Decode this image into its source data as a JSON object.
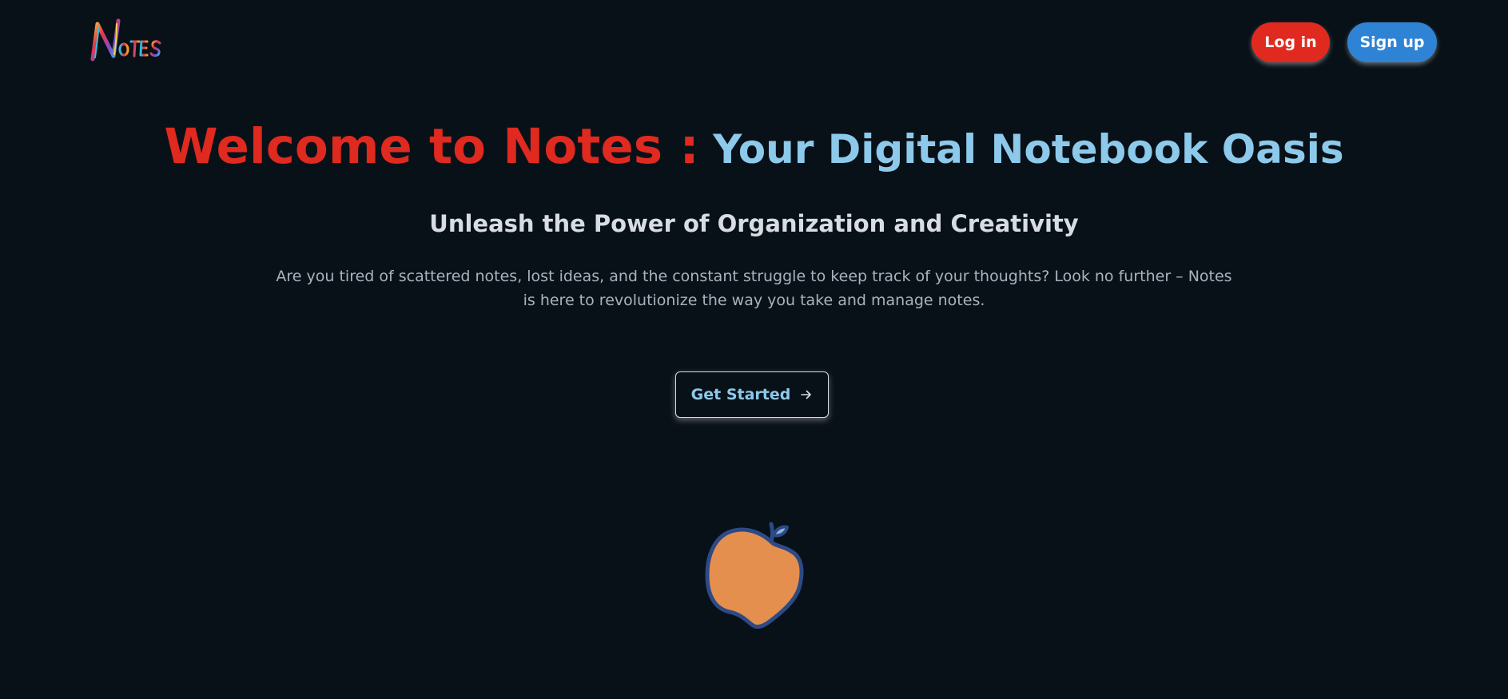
{
  "header": {
    "logo_text": "Notes",
    "login_label": "Log in",
    "signup_label": "Sign up"
  },
  "hero": {
    "title_main": "Welcome to Notes :",
    "title_accent": " Your Digital Notebook Oasis",
    "subtitle": "Unleash the Power of Organization and Creativity",
    "description": "Are you tired of scattered notes, lost ideas, and the constant struggle to keep track of your thoughts? Look no further – Notes is here to revolutionize the way you take and manage notes.",
    "cta_label": "Get Started",
    "cta_icon": "arrow-right-icon"
  },
  "illustration": {
    "icon": "apple-illustration"
  },
  "colors": {
    "background": "#091118",
    "title_red": "#e0291f",
    "title_blue": "#8dc9ea",
    "login_bg": "#e0291f",
    "signup_bg": "#2f83d5",
    "apple_fill": "#e58f4f",
    "apple_stroke": "#2c4a86"
  }
}
